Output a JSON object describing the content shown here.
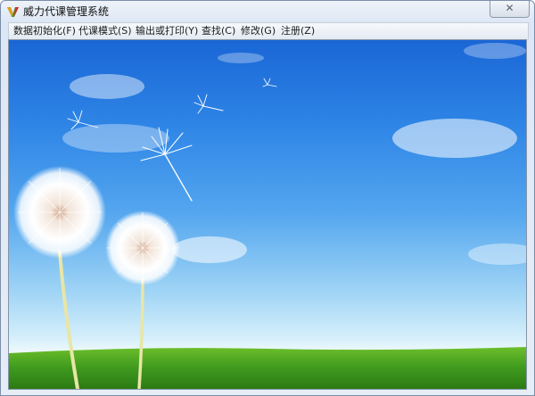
{
  "window": {
    "title": "威力代课管理系统",
    "close_label": "✕"
  },
  "menu": [
    {
      "label": "数据初始化(F)"
    },
    {
      "label": "代课模式(S)"
    },
    {
      "label": "输出或打印(Y)"
    },
    {
      "label": "查找(C)"
    },
    {
      "label": "修改(G)"
    },
    {
      "label": "注册(Z)"
    }
  ],
  "colors": {
    "sky_top": "#1a66d6",
    "sky_horizon": "#d8f0fb",
    "grass": "#3f9a1e"
  },
  "icons": {
    "app": "app-logo-icon",
    "close": "close-icon"
  }
}
